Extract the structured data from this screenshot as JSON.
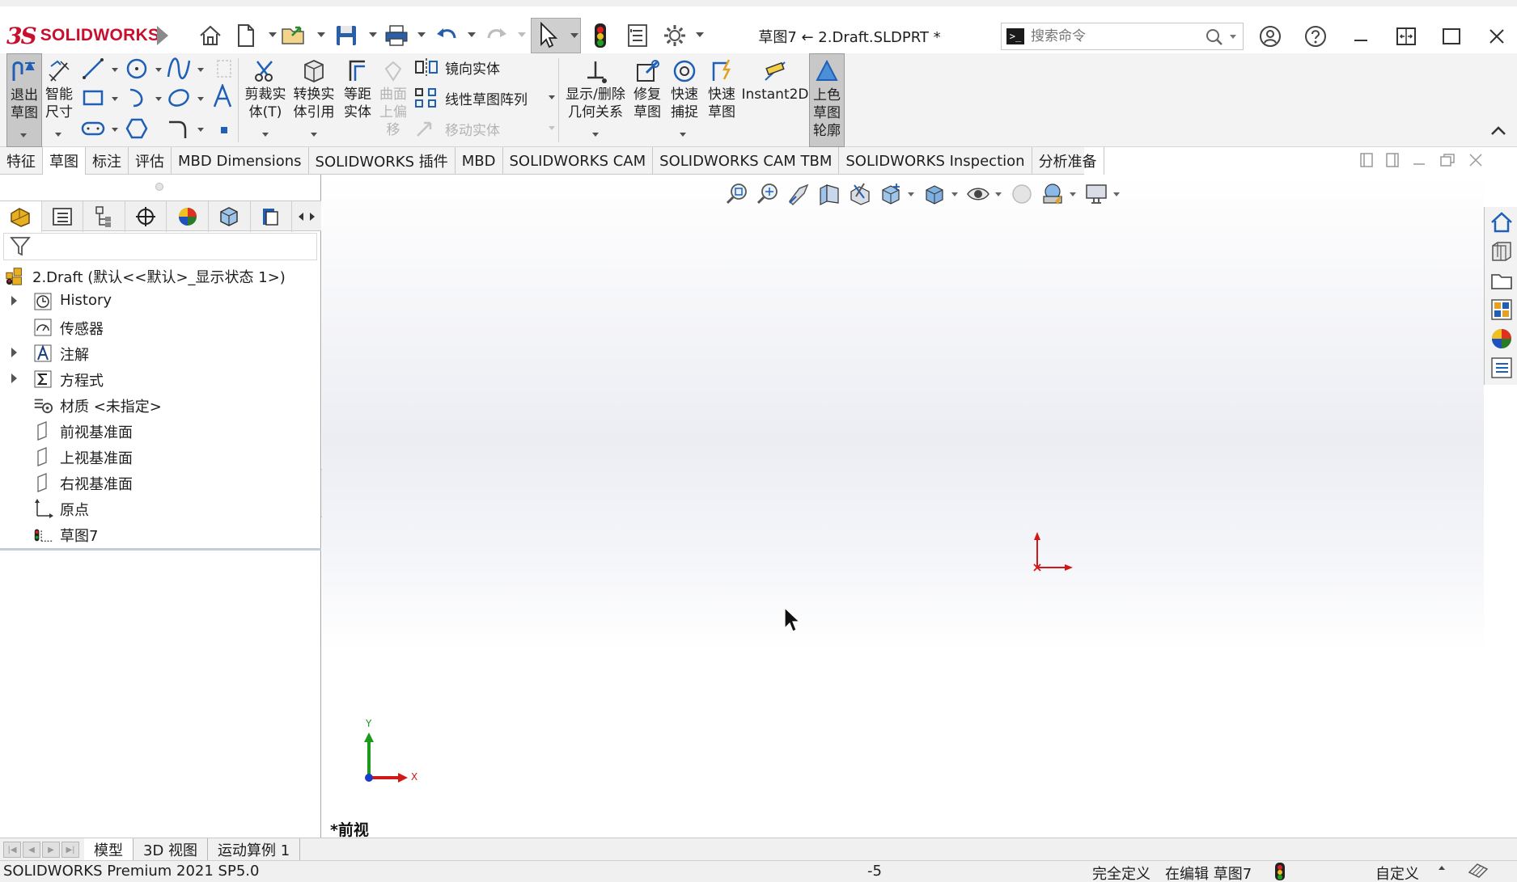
{
  "app": {
    "brand": "SOLIDWORKS",
    "doc_title": "草图7 ← 2.Draft.SLDPRT *",
    "search_placeholder": "搜索命令"
  },
  "command_manager": {
    "exit_sketch": "退出\n草图",
    "smart_dimension": "智能\n尺寸",
    "trim_entities": "剪裁实\n体(T)",
    "convert_entities": "转换实\n体引用",
    "offset_entities": "等距\n实体",
    "offset_on_surface": "曲面\n上偏\n移",
    "mirror_entities": "镜向实体",
    "linear_pattern": "线性草图阵列",
    "move_entities": "移动实体",
    "display_delete_relations": "显示/删除\n几何关系",
    "repair_sketch": "修复\n草图",
    "quick_snaps": "快速\n捕捉",
    "rapid_sketch": "快速\n草图",
    "instant2d": "Instant2D",
    "shaded_sketch_contours": "上色\n草图\n轮廓"
  },
  "tabs": [
    {
      "label": "特征"
    },
    {
      "label": "草图"
    },
    {
      "label": "标注"
    },
    {
      "label": "评估"
    },
    {
      "label": "MBD Dimensions"
    },
    {
      "label": "SOLIDWORKS 插件"
    },
    {
      "label": "MBD"
    },
    {
      "label": "SOLIDWORKS CAM"
    },
    {
      "label": "SOLIDWORKS CAM TBM"
    },
    {
      "label": "SOLIDWORKS Inspection"
    },
    {
      "label": "分析准备"
    }
  ],
  "active_tab": "草图",
  "feature_tree": {
    "root": "2.Draft  (默认<<默认>_显示状态 1>)",
    "items": [
      {
        "label": "History",
        "icon": "history-icon",
        "expandable": true
      },
      {
        "label": "传感器",
        "icon": "sensors-icon",
        "expandable": false
      },
      {
        "label": "注解",
        "icon": "annotations-icon",
        "expandable": true
      },
      {
        "label": "方程式",
        "icon": "equations-icon",
        "expandable": true
      },
      {
        "label": "材质 <未指定>",
        "icon": "material-icon",
        "expandable": false
      },
      {
        "label": "前视基准面",
        "icon": "plane-icon",
        "expandable": false
      },
      {
        "label": "上视基准面",
        "icon": "plane-icon",
        "expandable": false
      },
      {
        "label": "右视基准面",
        "icon": "plane-icon",
        "expandable": false
      },
      {
        "label": "原点",
        "icon": "origin-icon",
        "expandable": false
      },
      {
        "label": "草图7",
        "icon": "sketch-icon",
        "expandable": false
      }
    ]
  },
  "graphics": {
    "view_name": "*前视",
    "triad_x": "X",
    "triad_y": "Y"
  },
  "bottom_tabs": [
    {
      "label": "模型"
    },
    {
      "label": "3D 视图"
    },
    {
      "label": "运动算例 1"
    }
  ],
  "status": {
    "version": "SOLIDWORKS Premium 2021 SP5.0",
    "coord": "-5",
    "definition": "完全定义",
    "editing": "在编辑 草图7",
    "units": "自定义"
  },
  "colors": {
    "brand_red": "#c8102e",
    "accent_blue": "#1f5fb6",
    "tab_active": "#ffffff",
    "axis_red": "#d01818",
    "axis_green": "#1c9a1c",
    "axis_blue": "#1a3cc8"
  }
}
